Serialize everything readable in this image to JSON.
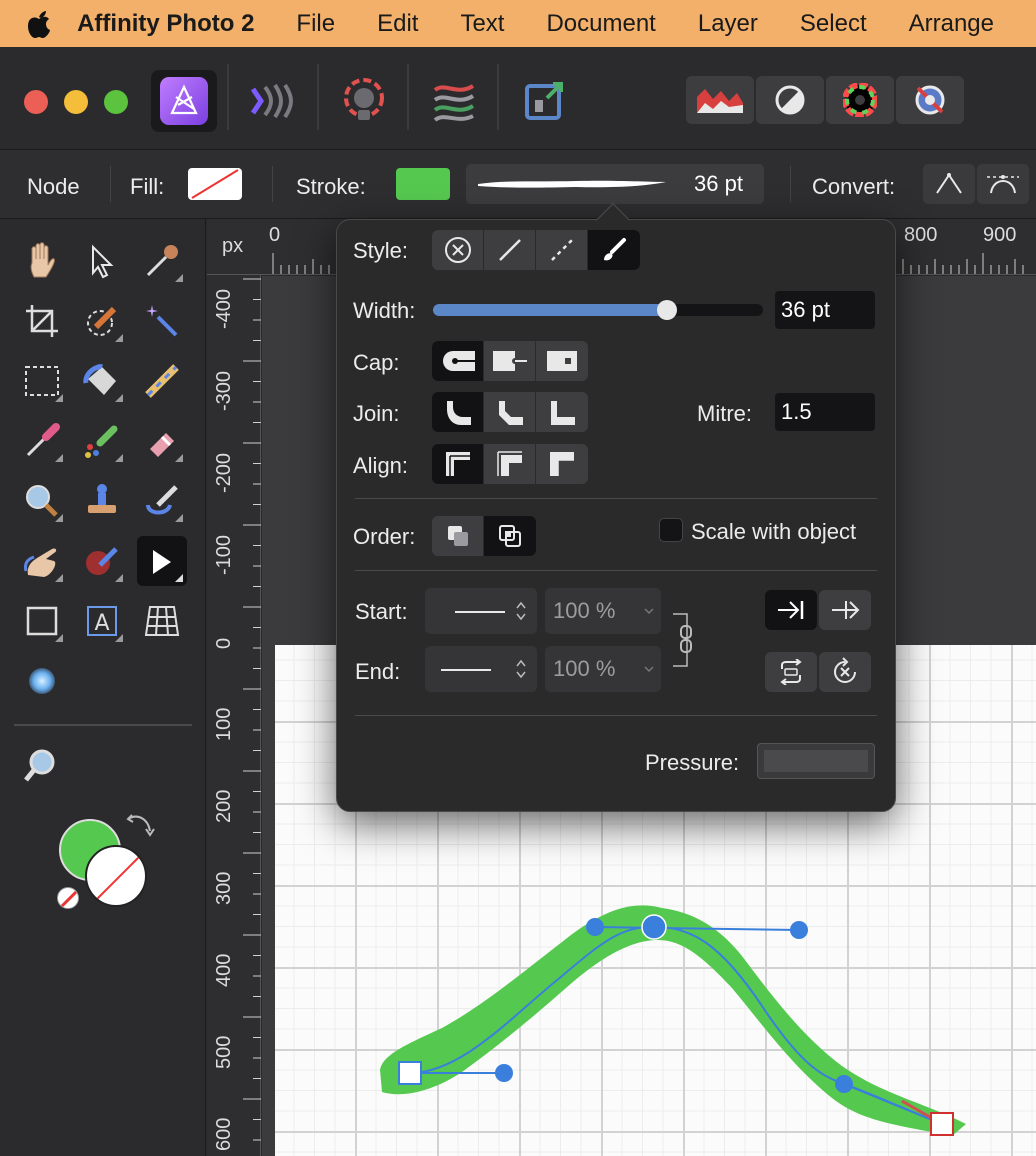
{
  "menubar": {
    "app_name": "Affinity Photo 2",
    "items": [
      "File",
      "Edit",
      "Text",
      "Document",
      "Layer",
      "Select",
      "Arrange"
    ]
  },
  "context_toolbar": {
    "tool_label": "Node",
    "fill_label": "Fill:",
    "stroke_label": "Stroke:",
    "stroke_color": "#55c94f",
    "stroke_width": "36 pt",
    "convert_label": "Convert:"
  },
  "rulers": {
    "unit": "px",
    "top_ticks": [
      "0",
      "800",
      "900"
    ],
    "left_ticks": [
      "-400",
      "-300",
      "-200",
      "-100",
      "0",
      "100",
      "200",
      "300",
      "400",
      "500",
      "600"
    ]
  },
  "stroke_panel": {
    "style_label": "Style:",
    "width_label": "Width:",
    "width_value": "36 pt",
    "width_slider_fraction": 0.71,
    "cap_label": "Cap:",
    "join_label": "Join:",
    "mitre_label": "Mitre:",
    "mitre_value": "1.5",
    "align_label": "Align:",
    "order_label": "Order:",
    "scale_with_object_label": "Scale with object",
    "scale_with_object_checked": false,
    "start_label": "Start:",
    "start_percent": "100 %",
    "end_label": "End:",
    "end_percent": "100 %",
    "pressure_label": "Pressure:"
  },
  "colors": {
    "accent_blue": "#3a7fdc",
    "stroke_green": "#55c94f",
    "menubar": "#f2b06b"
  }
}
